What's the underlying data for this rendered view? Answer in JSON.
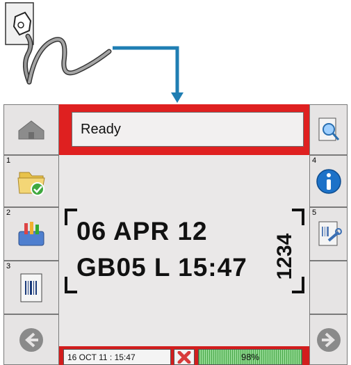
{
  "status": {
    "message": "Ready"
  },
  "print_message": {
    "line1": "06 APR 12",
    "line2": "GB05 L 15:47",
    "vertical_code": "1234"
  },
  "footer": {
    "datetime": "16 OCT 11 : 15:47",
    "ink_level_label": "98%",
    "ink_level_fraction": 0.98
  },
  "left_buttons": [
    {
      "number": "",
      "icon": "home-icon"
    },
    {
      "number": "1",
      "icon": "folder-check-icon"
    },
    {
      "number": "2",
      "icon": "toolbox-icon"
    },
    {
      "number": "3",
      "icon": "barcode-document-icon"
    },
    {
      "number": "",
      "icon": "back-arrow-icon"
    }
  ],
  "right_buttons": [
    {
      "number": "",
      "icon": "preview-search-icon"
    },
    {
      "number": "4",
      "icon": "info-icon"
    },
    {
      "number": "5",
      "icon": "settings-document-icon"
    },
    {
      "number": "",
      "icon": "blank"
    },
    {
      "number": "",
      "icon": "forward-arrow-icon"
    }
  ],
  "colors": {
    "status_frame": "#df2020",
    "panel": "#eae8e8",
    "ink_bar": "#8fd68f",
    "info_blue": "#1d72c8"
  }
}
